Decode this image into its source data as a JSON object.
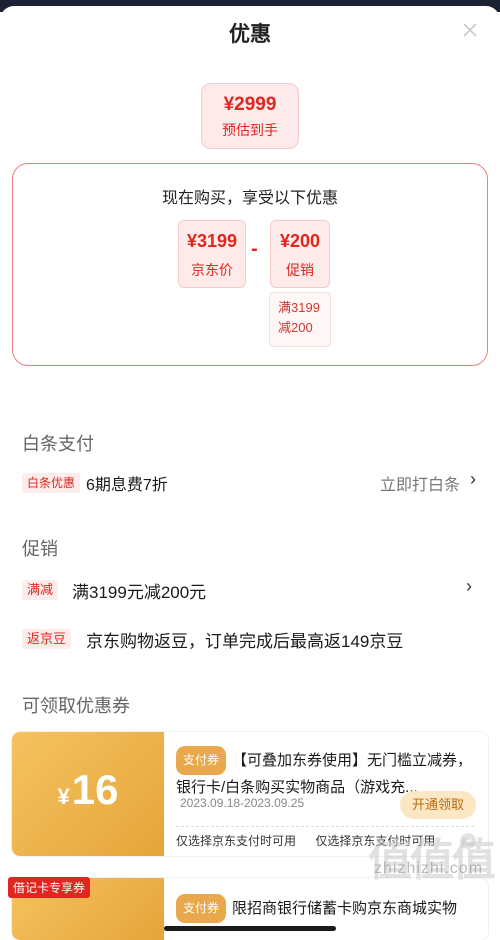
{
  "header": {
    "title": "优惠"
  },
  "estimate": {
    "price": "¥2999",
    "label": "预估到手"
  },
  "calc": {
    "title": "现在购买，享受以下优惠",
    "base": {
      "value": "¥3199",
      "label": "京东价"
    },
    "operator": "-",
    "discount": {
      "value": "¥200",
      "label": "促销"
    },
    "condition_line1": "满3199",
    "condition_line2": "减200"
  },
  "baitiao": {
    "title": "白条支付",
    "tag": "白条优惠",
    "text": "6期息费7折",
    "action": "立即打白条"
  },
  "promo": {
    "title": "促销",
    "items": [
      {
        "tag": "满减",
        "text": "满3199元减200元"
      },
      {
        "tag": "返京豆",
        "text": "京东购物返豆，订单完成后最高返149京豆"
      }
    ]
  },
  "coupons": {
    "title": "可领取优惠券",
    "items": [
      {
        "currency": "¥",
        "amount": "16",
        "tag": "支付券",
        "desc": "【可叠加东券使用】无门槛立减券，银行卡/白条购买实物商品（游戏充...",
        "date": "2023.09.18-2023.09.25",
        "button": "开通领取",
        "cond1": "仅选择京东支付时可用",
        "cond2": "仅选择京东支付时可用"
      },
      {
        "badge": "借记卡专享券",
        "tag": "支付券",
        "desc": "限招商银行储蓄卡购京东商城实物"
      }
    ]
  },
  "watermark": {
    "text": "zhizhizhi.com",
    "big": "值值值"
  },
  "colors": {
    "accent": "#e0261f",
    "coupon_gold": "#e5a53a",
    "tag_bg": "#fdecec"
  }
}
